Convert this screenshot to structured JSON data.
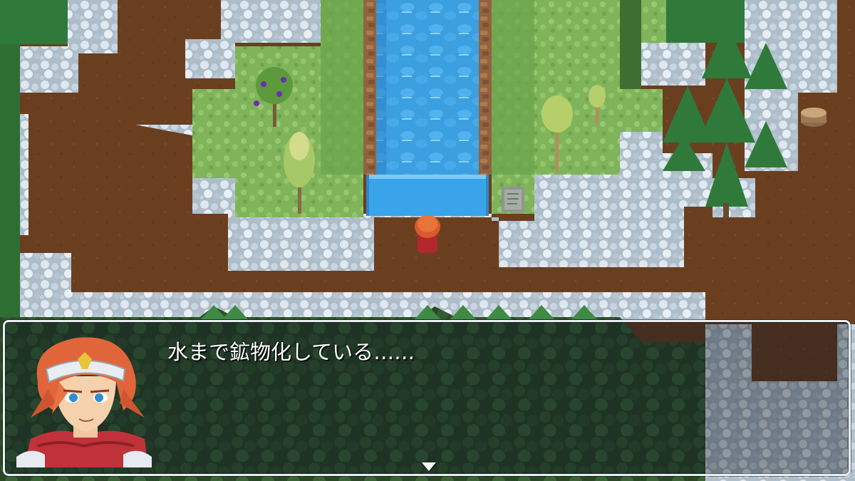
{
  "scene": {
    "terrain": "forest-waterfall",
    "palette": {
      "dirt": "#6a3f1f",
      "crystal_grass": "#c7d4df",
      "grass": "#86b85c",
      "waterfall": "#3fa6e6",
      "cliff": "#9b6a44",
      "pine": "#2f7a3a",
      "forest_dark": "#2d4e2b"
    }
  },
  "dialog": {
    "message": "水まで鉱物化している……",
    "speaker_portrait": "red-haired-hero-portrait",
    "advance_indicator": "down-triangle-icon"
  }
}
